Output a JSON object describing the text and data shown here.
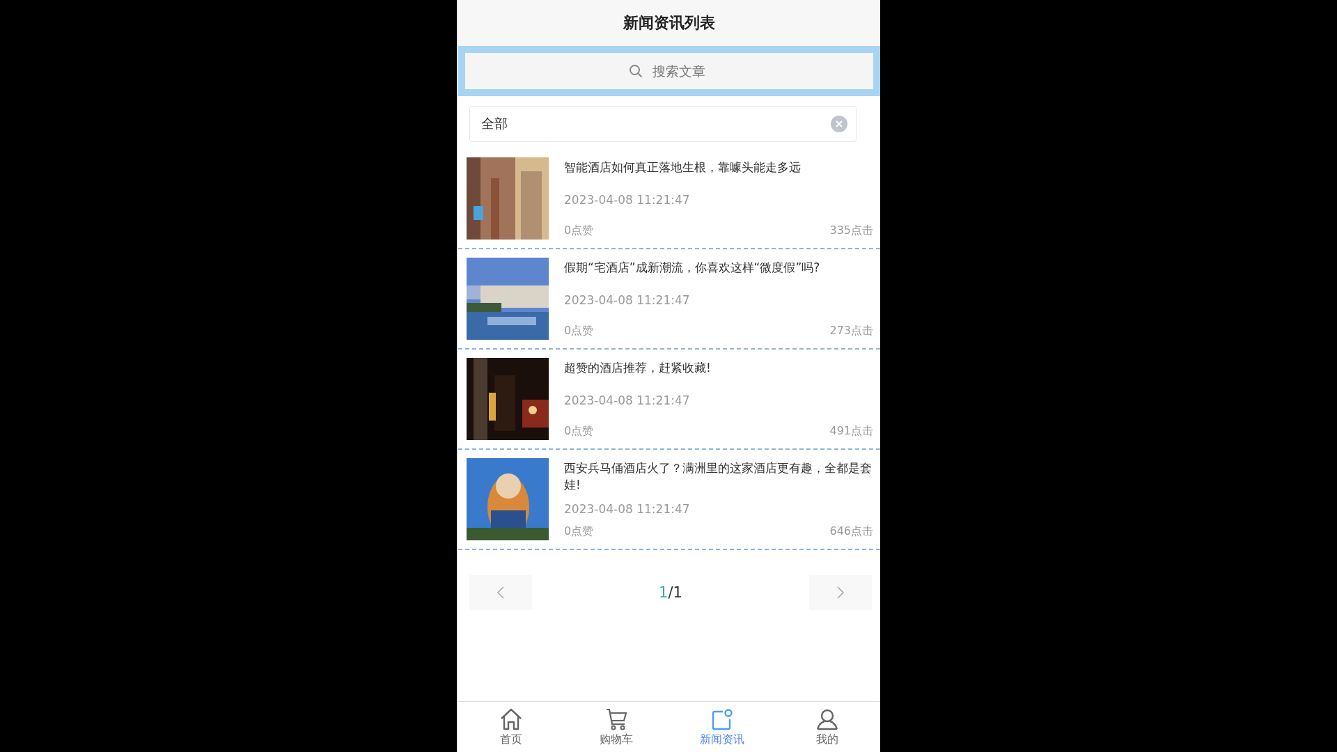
{
  "header": {
    "title": "新闻资讯列表"
  },
  "search": {
    "placeholder": "搜索文章"
  },
  "filter": {
    "value": "全部"
  },
  "articles": [
    {
      "title": "智能酒店如何真正落地生根，靠噱头能走多远",
      "date": "2023-04-08 11:21:47",
      "likes": "0点赞",
      "clicks": "335点击"
    },
    {
      "title": "假期“宅酒店”成新潮流，你喜欢这样“微度假”吗?",
      "date": "2023-04-08 11:21:47",
      "likes": "0点赞",
      "clicks": "273点击"
    },
    {
      "title": "超赞的酒店推荐，赶紧收藏!",
      "date": "2023-04-08 11:21:47",
      "likes": "0点赞",
      "clicks": "491点击"
    },
    {
      "title": "西安兵马俑酒店火了？满洲里的这家酒店更有趣，全都是套娃!",
      "date": "2023-04-08 11:21:47",
      "likes": "0点赞",
      "clicks": "646点击"
    }
  ],
  "pagination": {
    "current": "1",
    "total": "/1"
  },
  "tab_bar": [
    {
      "kind": "home",
      "label": "首页",
      "selected": false
    },
    {
      "kind": "cart",
      "label": "购物车",
      "selected": false
    },
    {
      "kind": "news",
      "label": "新闻资讯",
      "selected": true
    },
    {
      "kind": "user",
      "label": "我的",
      "selected": false
    }
  ]
}
